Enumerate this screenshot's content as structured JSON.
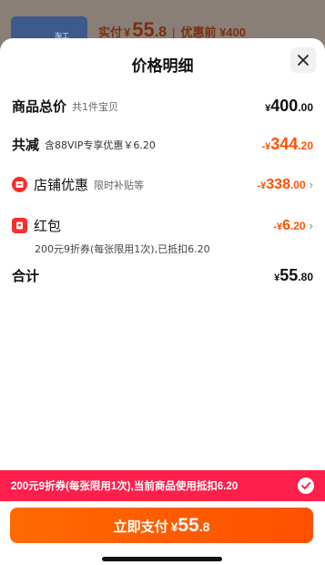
{
  "background": {
    "price_label": "实付",
    "currency": "¥",
    "price_int": "55",
    "price_dec": ".8",
    "separator": "|",
    "before_label": "优惠前 ¥400",
    "card_text": "淘工"
  },
  "sheet": {
    "title": "价格明细"
  },
  "rows": {
    "total": {
      "name": "商品总价",
      "sub": "共1件宝贝",
      "yen": "¥",
      "int": "400",
      "dec": ".00"
    },
    "discount": {
      "name": "共减",
      "sub": "含88VIP专享优惠￥6.20",
      "yen": "-¥",
      "int": "344",
      "dec": ".20"
    },
    "shop": {
      "name": "店铺优惠",
      "sub": "限时补贴等",
      "yen": "-¥",
      "int": "338",
      "dec": ".00",
      "chevron": "›"
    },
    "redpacket": {
      "name": "红包",
      "yen": "-¥",
      "int": "6",
      "dec": ".20",
      "chevron": "›",
      "note": "200元9折券(每张限用1次),已抵扣6.20"
    },
    "sum": {
      "name": "合计",
      "yen": "¥",
      "int": "55",
      "dec": ".80"
    }
  },
  "promo": {
    "text": "200元9折券(每张限用1次),当前商品使用抵扣6.20"
  },
  "pay": {
    "label": "立即支付",
    "yen": "¥",
    "int": "55",
    "dec": ".8"
  },
  "colors": {
    "accent": "#ff5000",
    "promo": "#ff1f4c",
    "icon_red": "#ff2a2a"
  },
  "icons": [
    "close-icon",
    "shop-icon",
    "redpacket-icon",
    "check-icon",
    "chevron-right-icon"
  ]
}
